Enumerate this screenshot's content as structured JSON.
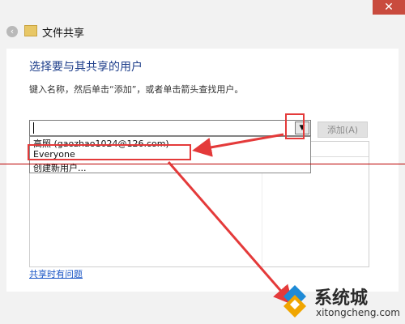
{
  "window": {
    "title": "文件共享",
    "close_glyph": "✕",
    "back_glyph": "‹"
  },
  "content": {
    "heading": "选择要与其共享的用户",
    "instruction": "键入名称，然后单击“添加”，或者单击箭头查找用户。",
    "combo": {
      "value": "",
      "placeholder": ""
    },
    "add_button_label": "添加(A)",
    "dropdown_items": [
      "高照 (gaozhao1024@126.com)",
      "Everyone",
      "创建新用户..."
    ],
    "help_link": "共享时有问题"
  },
  "watermark": {
    "brand": "系统城",
    "url": "xitongcheng.com"
  },
  "colors": {
    "annotation_red": "#e43a3a",
    "heading_blue": "#1f3f8b",
    "link_blue": "#1a55c5"
  }
}
